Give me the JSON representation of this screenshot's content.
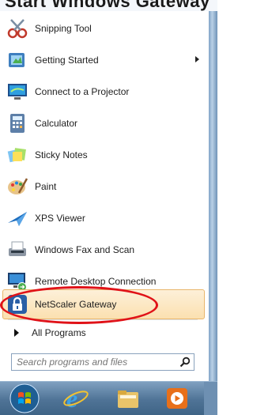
{
  "top_text": "Start Windows Gateway",
  "menu": {
    "items": [
      {
        "label": "Snipping Tool",
        "icon": "scissors-icon"
      },
      {
        "label": "Getting Started",
        "icon": "getting-started-icon",
        "has_submenu": true
      },
      {
        "label": "Connect to a Projector",
        "icon": "projector-icon"
      },
      {
        "label": "Calculator",
        "icon": "calculator-icon"
      },
      {
        "label": "Sticky Notes",
        "icon": "sticky-notes-icon"
      },
      {
        "label": "Paint",
        "icon": "paint-palette-icon"
      },
      {
        "label": "XPS Viewer",
        "icon": "xps-viewer-icon"
      },
      {
        "label": "Windows Fax and Scan",
        "icon": "fax-scan-icon"
      },
      {
        "label": "Remote Desktop Connection",
        "icon": "remote-desktop-icon"
      },
      {
        "label": "NetScaler Gateway",
        "icon": "lock-icon",
        "highlighted": true,
        "annotation": "red-ellipse"
      }
    ],
    "all_programs_label": "All Programs"
  },
  "search": {
    "placeholder": "Search programs and files",
    "icon": "search-icon"
  },
  "taskbar": {
    "items": [
      "start-orb-icon",
      "internet-explorer-icon",
      "file-explorer-icon",
      "media-player-icon"
    ]
  },
  "colors": {
    "highlight": "#fbe0b0",
    "annotation": "#e01218",
    "taskbar": "#4f7396"
  }
}
